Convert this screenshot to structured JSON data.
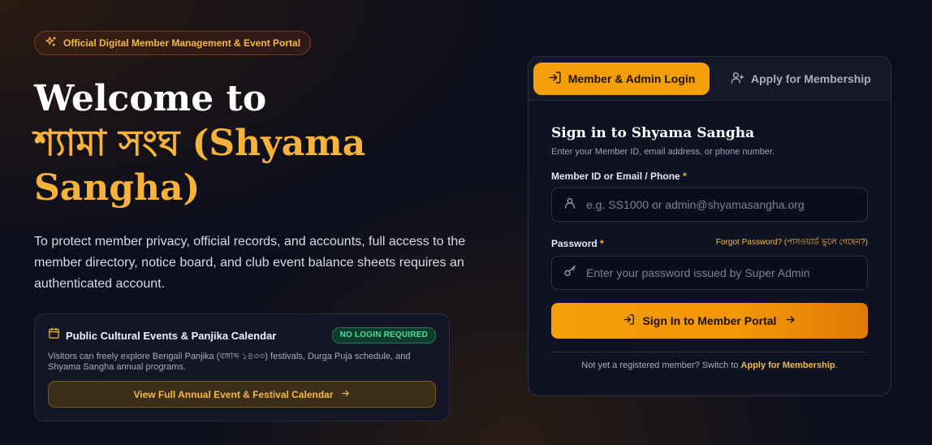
{
  "badge": {
    "icon": "sparkles-icon",
    "label": "Official Digital Member Management & Event Portal"
  },
  "hero": {
    "title_line1": "Welcome to",
    "title_accent": "শ্যামা সংঘ (Shyama Sangha)",
    "description": "To protect member privacy, official records, and accounts, full access to the member directory, notice board, and club event balance sheets requires an authenticated account."
  },
  "public_card": {
    "icon": "calendar-icon",
    "title": "Public Cultural Events & Panjika Calendar",
    "pill": "NO LOGIN REQUIRED",
    "description": "Visitors can freely explore Bengali Panjika (বঙ্গাব্দ ১৪৩৩) festivals, Durga Puja schedule, and Shyama Sangha annual programs.",
    "button_label": "View Full Annual Event & Festival Calendar",
    "button_icon": "arrow-right-icon"
  },
  "tabs": {
    "login": {
      "label": "Member & Admin Login",
      "icon": "login-icon"
    },
    "apply": {
      "label": "Apply for Membership",
      "icon": "user-plus-icon"
    }
  },
  "login_form": {
    "title": "Sign in to Shyama Sangha",
    "subtitle": "Enter your Member ID, email address, or phone number.",
    "id_label": "Member ID or Email / Phone",
    "required_mark": "*",
    "id_placeholder": "e.g. SS1000 or admin@shyamasangha.org",
    "id_value": "",
    "password_label": "Password",
    "forgot_label": "Forgot Password? (পাসওয়ার্ড ভুলে গেছেন?)",
    "password_placeholder": "Enter your password issued by Super Admin",
    "password_value": "",
    "submit_label": "Sign In to Member Portal",
    "footer_text": "Not yet a registered member? Switch to",
    "footer_link": "Apply for Membership",
    "footer_end": "."
  },
  "colors": {
    "accent": "#f59e0b",
    "background": "#0b0e1c",
    "success": "#4ade9a"
  }
}
